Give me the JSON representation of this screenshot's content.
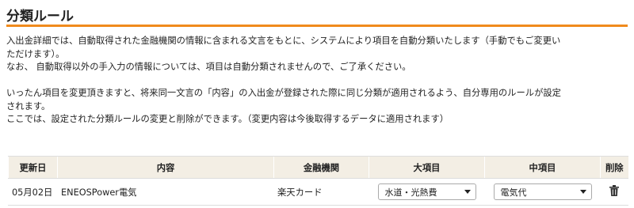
{
  "page": {
    "title": "分類ルール",
    "description": [
      "入出金詳細では、自動取得された金融機関の情報に含まれる文言をもとに、システムにより項目を自動分類いたします（手動でもご変更い",
      "ただけます）。",
      "なお、 自動取得以外の手入力の情報については、項目は自動分類されませんので、ご了承ください。",
      "",
      "いったん項目を変更頂きますと、将来同一文言の「内容」の入出金が登録された際に同じ分類が適用されるよう、自分専用のルールが設定",
      "されます。",
      "ここでは、設定された分類ルールの変更と削除ができます。（変更内容は今後取得するデータに適用されます）"
    ]
  },
  "table": {
    "headers": {
      "date": "更新日",
      "content": "内容",
      "institution": "金融機関",
      "major": "大項目",
      "middle": "中項目",
      "delete": "削除"
    },
    "rows": [
      {
        "date": "05月02日",
        "content": "ENEOSPower電気",
        "institution": "楽天カード",
        "major": "水道・光熱費",
        "middle": "電気代",
        "delete_icon": "trash-icon"
      }
    ]
  }
}
